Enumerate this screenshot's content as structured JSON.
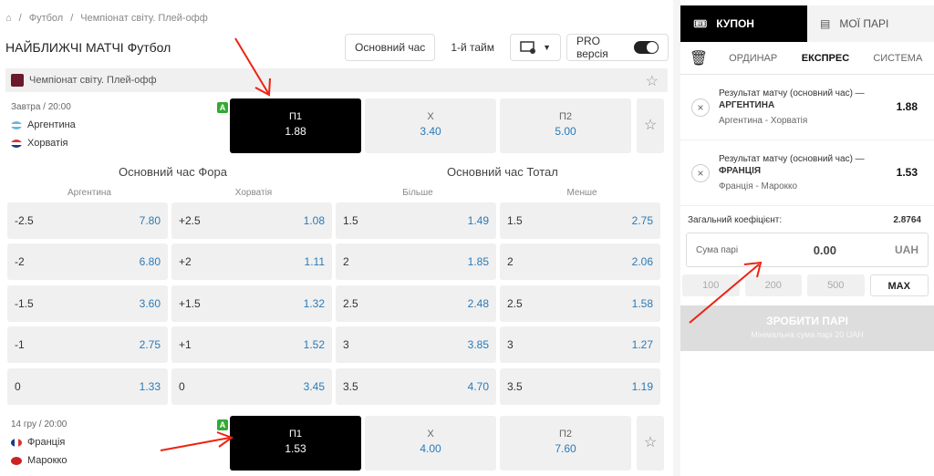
{
  "breadcrumb": {
    "home": "⌂",
    "sep": "/",
    "items": [
      "Футбол",
      "Чемпіонат світу. Плей-офф"
    ]
  },
  "page": {
    "title": "НАЙБЛИЖЧІ МАТЧІ",
    "subtitle": "Футбол"
  },
  "toolbar": {
    "main_time": "Основний час",
    "first_half": "1-й тайм",
    "pro": "PRO версія"
  },
  "league": {
    "name": "Чемпіонат світу. Плей-офф"
  },
  "matches": [
    {
      "time": "Завтра / 20:00",
      "badge": "A",
      "team1": "Аргентина",
      "team2": "Хорватія",
      "odds": [
        {
          "label": "П1",
          "value": "1.88"
        },
        {
          "label": "X",
          "value": "3.40"
        },
        {
          "label": "П2",
          "value": "5.00"
        }
      ]
    },
    {
      "time": "14 гру / 20:00",
      "badge": "A",
      "team1": "Франція",
      "team2": "Марокко",
      "odds": [
        {
          "label": "П1",
          "value": "1.53"
        },
        {
          "label": "X",
          "value": "4.00"
        },
        {
          "label": "П2",
          "value": "7.60"
        }
      ]
    }
  ],
  "markets": {
    "handicap_title": "Основний час Фора",
    "total_title": "Основний час Тотал",
    "columns": [
      "Аргентина",
      "Хорватія",
      "Більше",
      "Менше"
    ],
    "rows": [
      [
        [
          "-2.5",
          "7.80"
        ],
        [
          "+2.5",
          "1.08"
        ],
        [
          "1.5",
          "1.49"
        ],
        [
          "1.5",
          "2.75"
        ]
      ],
      [
        [
          "-2",
          "6.80"
        ],
        [
          "+2",
          "1.11"
        ],
        [
          "2",
          "1.85"
        ],
        [
          "2",
          "2.06"
        ]
      ],
      [
        [
          "-1.5",
          "3.60"
        ],
        [
          "+1.5",
          "1.32"
        ],
        [
          "2.5",
          "2.48"
        ],
        [
          "2.5",
          "1.58"
        ]
      ],
      [
        [
          "-1",
          "2.75"
        ],
        [
          "+1",
          "1.52"
        ],
        [
          "3",
          "3.85"
        ],
        [
          "3",
          "1.27"
        ]
      ],
      [
        [
          "0",
          "1.33"
        ],
        [
          "0",
          "3.45"
        ],
        [
          "3.5",
          "4.70"
        ],
        [
          "3.5",
          "1.19"
        ]
      ]
    ]
  },
  "coupon": {
    "tab_coupon": "КУПОН",
    "tab_my_bets": "МОЇ ПАРІ",
    "subtabs": [
      "ОРДИНАР",
      "ЕКСПРЕС",
      "СИСТЕМА"
    ],
    "bets": [
      {
        "market": "Результат матчу (основний час) —",
        "pick": "АРГЕНТИНА",
        "match": "Аргентина - Хорватія",
        "odd": "1.88"
      },
      {
        "market": "Результат матчу (основний час) —",
        "pick": "ФРАНЦІЯ",
        "match": "Франція - Марокко",
        "odd": "1.53"
      }
    ],
    "total_label": "Загальний коефіцієнт:",
    "total_value": "2.8764",
    "stake_label": "Сума парі",
    "stake_value": "0.00",
    "currency": "UAH",
    "quick": [
      "100",
      "200",
      "500",
      "MAX"
    ],
    "place_label": "ЗРОБИТИ ПАРІ",
    "min_label": "Мінімальна сума парі 20 UAH"
  }
}
